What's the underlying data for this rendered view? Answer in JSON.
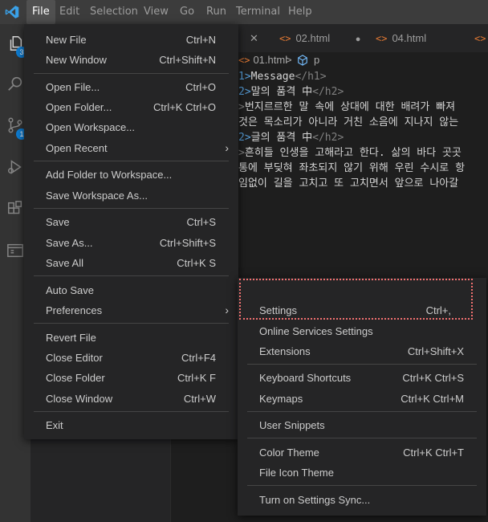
{
  "menubar": {
    "items": [
      {
        "label": "File",
        "active": true
      },
      {
        "label": "Edit"
      },
      {
        "label": "Selection"
      },
      {
        "label": "View"
      },
      {
        "label": "Go"
      },
      {
        "label": "Run"
      },
      {
        "label": "Terminal"
      },
      {
        "label": "Help"
      }
    ]
  },
  "activitybar": {
    "icons": [
      "files-icon",
      "search-icon",
      "source-control-icon",
      "run-debug-icon",
      "extensions-icon",
      "remote-explorer-icon"
    ],
    "explorer_badge": "3",
    "scm_badge": "1"
  },
  "tabs": [
    {
      "label": "",
      "close": "✕"
    },
    {
      "label": "02.html",
      "icon": "<>",
      "dirty": "●"
    },
    {
      "label": "04.html",
      "icon": "<>"
    },
    {
      "label": "",
      "icon": "<>"
    }
  ],
  "breadcrumb": {
    "file_icon": "<>",
    "file": "01.html",
    "sep": ">",
    "symbol": "p"
  },
  "code": {
    "lines": [
      {
        "prefix": "1>",
        "text": "Message",
        "close_tag": "</h1>"
      },
      {
        "prefix": "2>",
        "text": "말의 품격 中",
        "close_tag": "</h2>"
      },
      {
        "prefix": ">",
        "text": "번지르르한 말 속에 상대에 대한 배려가 빠져"
      },
      {
        "prefix": "",
        "text": "것은 목소리가 아니라 거친 소음에 지나지 않는"
      },
      {
        "prefix": "2>",
        "text": "글의 품격 中",
        "close_tag": "</h2>"
      },
      {
        "prefix": ">",
        "text": "흔히들 인생을 고해라고 한다. 삶의 바다 곳곳"
      },
      {
        "prefix": "",
        "text": "통에 부딪혀 좌초되지 않기 위해 우린 수시로 항"
      },
      {
        "prefix": "",
        "text": "임없이 길을 고치고 또 고치면서 앞으로 나아갈"
      }
    ]
  },
  "file_menu": {
    "items": [
      {
        "label": "New File",
        "shortcut": "Ctrl+N"
      },
      {
        "label": "New Window",
        "shortcut": "Ctrl+Shift+N"
      },
      {
        "label": "Open File...",
        "shortcut": "Ctrl+O"
      },
      {
        "label": "Open Folder...",
        "shortcut": "Ctrl+K Ctrl+O"
      },
      {
        "label": "Open Workspace...",
        "shortcut": ""
      },
      {
        "label": "Open Recent",
        "shortcut": "",
        "submenu": "›"
      },
      {
        "label": "Add Folder to Workspace...",
        "shortcut": ""
      },
      {
        "label": "Save Workspace As...",
        "shortcut": ""
      },
      {
        "label": "Save",
        "shortcut": "Ctrl+S"
      },
      {
        "label": "Save As...",
        "shortcut": "Ctrl+Shift+S"
      },
      {
        "label": "Save All",
        "shortcut": "Ctrl+K S"
      },
      {
        "label": "Auto Save",
        "shortcut": ""
      },
      {
        "label": "Preferences",
        "shortcut": "",
        "submenu": "›"
      },
      {
        "label": "Revert File",
        "shortcut": ""
      },
      {
        "label": "Close Editor",
        "shortcut": "Ctrl+F4"
      },
      {
        "label": "Close Folder",
        "shortcut": "Ctrl+K F"
      },
      {
        "label": "Close Window",
        "shortcut": "Ctrl+W"
      },
      {
        "label": "Exit",
        "shortcut": ""
      }
    ]
  },
  "preferences_menu": {
    "items": [
      {
        "label": "Settings",
        "shortcut": "Ctrl+,"
      },
      {
        "label": "Online Services Settings",
        "shortcut": ""
      },
      {
        "label": "Extensions",
        "shortcut": "Ctrl+Shift+X"
      },
      {
        "label": "Keyboard Shortcuts",
        "shortcut": "Ctrl+K Ctrl+S"
      },
      {
        "label": "Keymaps",
        "shortcut": "Ctrl+K Ctrl+M"
      },
      {
        "label": "User Snippets",
        "shortcut": ""
      },
      {
        "label": "Color Theme",
        "shortcut": "Ctrl+K Ctrl+T"
      },
      {
        "label": "File Icon Theme",
        "shortcut": ""
      },
      {
        "label": "Turn on Settings Sync...",
        "shortcut": ""
      }
    ]
  },
  "colors": {
    "accent": "#0e7dd3",
    "menu_bg": "#252526",
    "highlight": "#f07070",
    "html_icon": "#e37933",
    "tag": "#569cd6"
  }
}
